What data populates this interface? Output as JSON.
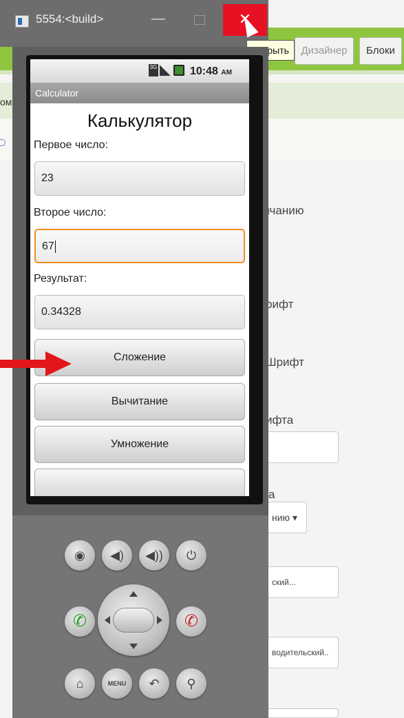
{
  "window": {
    "title": "5554:<build>",
    "minimize_glyph": "—",
    "close_glyph": "✕",
    "close_tooltip": "Закрыть"
  },
  "designer": {
    "designer_button": "Дизайнер",
    "blocks_button": "Блоки",
    "left_cut_label": "ом",
    "property_fragments": [
      "лчанию",
      "рифт",
      "Шрифт",
      "ифта",
      "а"
    ],
    "dropdown_value": "нию",
    "input_fragments": [
      "ский...",
      "водительский.."
    ]
  },
  "phone": {
    "status": {
      "network": "3G",
      "time": "10:48",
      "ampm": "AM"
    },
    "app_title": "Calculator",
    "heading": "Калькулятор",
    "first_label": "Первое число:",
    "first_value": "23",
    "second_label": "Второе число:",
    "second_value": "67",
    "result_label": "Результат:",
    "result_value": "0.34328",
    "buttons": {
      "add": "Сложение",
      "subtract": "Вычитание",
      "multiply": "Умножение"
    }
  },
  "hardware": {
    "camera_glyph": "◉",
    "vol_down_glyph": "◀)",
    "vol_up_glyph": "◀))",
    "power_glyph": "⏻",
    "call_glyph": "✆",
    "end_glyph": "✆",
    "home_glyph": "⌂",
    "menu_label": "MENU",
    "back_glyph": "↶",
    "search_glyph": "⚲"
  },
  "colors": {
    "accent_green": "#8ec63f",
    "close_red": "#e81123",
    "focus_orange": "#f08d22",
    "arrow_red": "#e3161a"
  }
}
